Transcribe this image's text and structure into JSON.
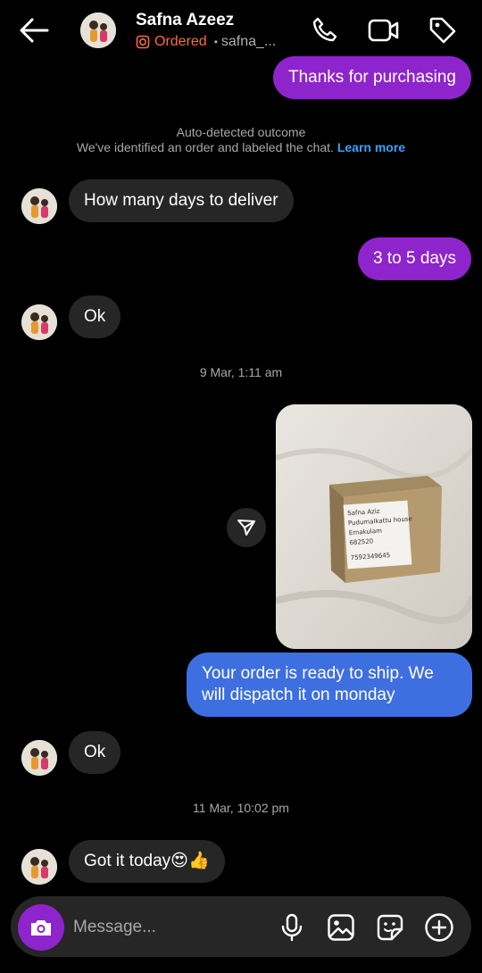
{
  "header": {
    "contact_name": "Safna Azeez",
    "status_label": "Ordered",
    "separator": "•",
    "username": "safna_..."
  },
  "messages": {
    "m1": "Thanks for purchasing",
    "m2": "How many days to deliver",
    "m3": "3 to 5 days",
    "m4": "Ok",
    "m5": "Your order is ready to ship. We will dispatch it on monday",
    "m6": "Ok",
    "m7": "Got it today😍👍"
  },
  "system_notice": {
    "title": "Auto-detected outcome",
    "text": "We've identified an order and labeled the chat.",
    "link": "Learn more"
  },
  "timestamps": {
    "t1": "9 Mar, 1:11 am",
    "t2": "11 Mar, 10:02 pm"
  },
  "photo_label": {
    "line1": "Safna Aziz",
    "line2": "Pudumalkattu house",
    "line3": "Ernakulam",
    "line4": "682520",
    "line5": "7592349645"
  },
  "composer": {
    "placeholder": "Message..."
  },
  "colors": {
    "outgoing_purple": "#8e24cc",
    "outgoing_blue": "#3e6fe0",
    "incoming": "#262626",
    "ordered_orange": "#ff6a3d",
    "link_blue": "#3aa0ff"
  }
}
